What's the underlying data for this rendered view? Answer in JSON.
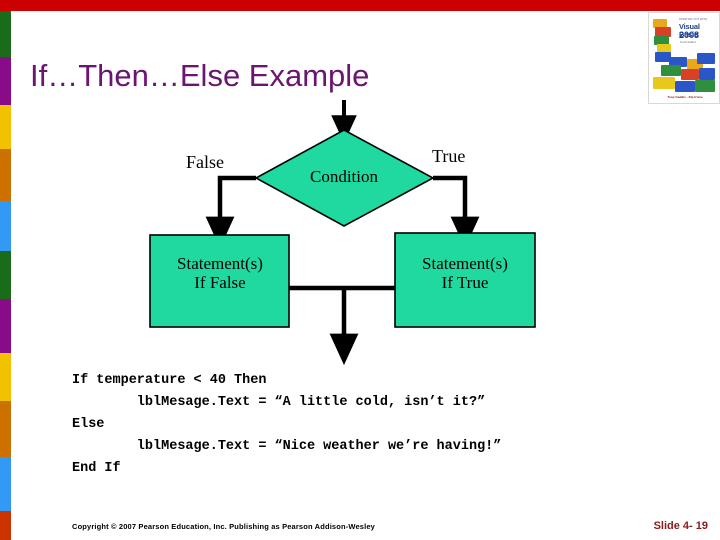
{
  "theme": {
    "top_bar_color": "#cc0000",
    "title_color": "#6a1570",
    "shape_fill": "#1fd9a0",
    "shape_stroke": "#000000",
    "slide_number_color": "#8b1a1a",
    "strip_bands": [
      {
        "name": "green",
        "color": "#1a6b1a",
        "height": 46
      },
      {
        "name": "purple",
        "color": "#8a0b8a",
        "height": 48
      },
      {
        "name": "yellow",
        "color": "#f2c200",
        "height": 44
      },
      {
        "name": "orange",
        "color": "#cc7000",
        "height": 52
      },
      {
        "name": "blue",
        "color": "#3399f5",
        "height": 50
      },
      {
        "name": "green",
        "color": "#1a6b1a",
        "height": 48
      },
      {
        "name": "purple",
        "color": "#8a0b8a",
        "height": 54
      },
      {
        "name": "yellow",
        "color": "#f2c200",
        "height": 48
      },
      {
        "name": "orange",
        "color": "#cc7000",
        "height": 56
      },
      {
        "name": "blue",
        "color": "#3399f5",
        "height": 54
      },
      {
        "name": "red",
        "color": "#cc3300",
        "height": 29
      }
    ]
  },
  "book_cover": {
    "headline": "STARTING OUT WITH",
    "title": "Visual Basic",
    "year": "2008",
    "subtitle": "Fourth Edition",
    "authors": "Tony Gaddis  ·  Kip Irvine"
  },
  "title": {
    "text": "If…Then…Else Example"
  },
  "flowchart": {
    "decision": {
      "label": "Condition"
    },
    "branch_false_label": "False",
    "branch_true_label": "True",
    "process_false": {
      "line1": "Statement(s)",
      "line2": "If False"
    },
    "process_true": {
      "line1": "Statement(s)",
      "line2": "If True"
    }
  },
  "code": {
    "text": "If temperature < 40 Then\n        lblMesage.Text = “A little cold, isn’t it?”\nElse\n        lblMesage.Text = “Nice weather we’re having!”\nEnd If"
  },
  "footer": {
    "copyright": "Copyright © 2007 Pearson Education, Inc. Publishing as Pearson Addison-Wesley",
    "slide_number": "Slide 4- 19"
  }
}
